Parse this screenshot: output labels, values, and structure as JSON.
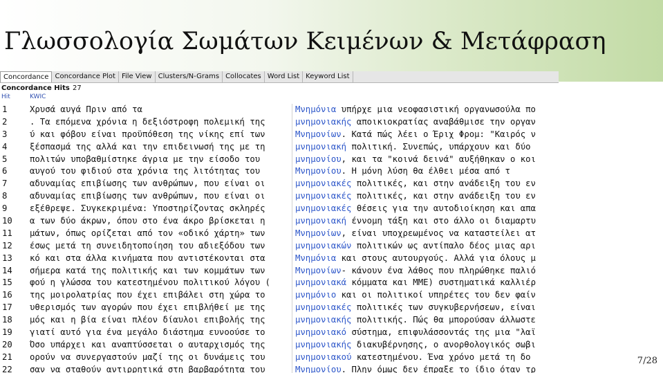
{
  "slide": {
    "title": "Γλωσσολογία Σωμάτων Κειμένων & Μετάφραση",
    "page_number": "7/28"
  },
  "app": {
    "tabs": [
      {
        "label": "Concordance",
        "active": true
      },
      {
        "label": "Concordance Plot",
        "active": false
      },
      {
        "label": "File View",
        "active": false
      },
      {
        "label": "Clusters/N-Grams",
        "active": false
      },
      {
        "label": "Collocates",
        "active": false
      },
      {
        "label": "Word List",
        "active": false
      },
      {
        "label": "Keyword List",
        "active": false
      }
    ],
    "hits_label": "Concordance Hits",
    "hits_count": "27",
    "columns": {
      "hit": "Hit",
      "kwic": "KWIC"
    },
    "keyword_color": "#2b55c9",
    "rows": [
      {
        "num": "1",
        "left": "Χρυσά αυγά  Πριν από τα ",
        "kw": "Μνημόνια",
        "right": " υπήρχε μια νεοφασιστική οργανωσούλα πο"
      },
      {
        "num": "2",
        "left": ". Τα επόμενα χρόνια η δεξιόστροφη πολεμική της ",
        "kw": "μνημονιακής",
        "right": " αποικιοκρατίας αναβάθμισε την οργαν"
      },
      {
        "num": "3",
        "left": "ύ και φόβου είναι προϋπόθεση της νίκης επί των ",
        "kw": "Μνημονίων",
        "right": ". Κατά πώς λέει ο Έριχ Φρομ: \"Καιρός ν"
      },
      {
        "num": "4",
        "left": "ξέσπασμά της αλλά και την επιδεινωσή της με τη ",
        "kw": "μνημονιακή",
        "right": " πολιτική.  Συνεπώς, υπάρχουν και δύο"
      },
      {
        "num": "5",
        "left": " πολιτών υποβαθμίστηκε άγρια με την είσοδο του ",
        "kw": "μνημονίου",
        "right": ", και τα \"κοινά δεινά\" αυξήθηκαν ο κοι"
      },
      {
        "num": "6",
        "left": " αυγού του φιδιού στα χρόνια της λιτότητας του ",
        "kw": "Μνημονίου",
        "right": ".    Η μόνη λύση θα έλθει μέσα από τ"
      },
      {
        "num": "7",
        "left": "αδυναμίας επιβίωσης των ανθρώπων, που είναι οι ",
        "kw": "μνημονιακές",
        "right": " πολιτικές, και στην ανάδειξη του εν"
      },
      {
        "num": "8",
        "left": "αδυναμίας επιβίωσης των ανθρώπων, που είναι οι ",
        "kw": "μνημονιακές",
        "right": " πολιτικές, και στην ανάδειξη του εν"
      },
      {
        "num": "9",
        "left": "εξέθρεψε. Συγκεκριμένα: Υποστηρίζοντας σκληρές ",
        "kw": "μνημονιακές",
        "right": " θέσεις για την αυτοδιοίκηση και απα"
      },
      {
        "num": "10",
        "left": "α των δύο άκρων, όπου στο ένα άκρο βρίσκεται η ",
        "kw": "μνημονιακή",
        "right": " έννομη τάξη και στο άλλο οι διαμαρτυ"
      },
      {
        "num": "11",
        "left": "μάτων, όπως ορίζεται από τον «οδικό χάρτη» των ",
        "kw": "Μνημονίων",
        "right": ", είναι υποχρεωμένος να καταστείλει ατ"
      },
      {
        "num": "12",
        "left": "έσως μετά τη συνειδητοποίηση του αδιεξόδου των ",
        "kw": "μνημονιακών",
        "right": " πολιτικών ως αντίπαλο δέος μιας αρι"
      },
      {
        "num": "13",
        "left": "κό και στα άλλα κινήματα που αντιστέκονται στα ",
        "kw": "Μνημόνια",
        "right": " και στους αυτουργούς. Αλλά για όλους μ"
      },
      {
        "num": "14",
        "left": "σήμερα κατά της πολιτικής και των κομμάτων των ",
        "kw": "Μνημονίων",
        "right": "- κάνουν ένα λάθος που πληρώθηκε παλιό"
      },
      {
        "num": "15",
        "left": "φού η γλώσσα του κατεστημένου πολιτικού λόγου ( ",
        "kw": "μνημονιακά",
        "right": " κόμματα και ΜΜΕ) συστηματικά καλλιέρ"
      },
      {
        "num": "16",
        "left": "της μοιρολατρίας που έχει επιβάλει στη χώρα το ",
        "kw": "μνημόνιο",
        "right": " και οι πολιτικοί υπηρέτες του δεν φαίν"
      },
      {
        "num": "17",
        "left": "υθερισμός των αγορών που έχει επιβλήθεί με της ",
        "kw": "μνημονιακές",
        "right": " πολιτικές των συγκυβερνήσεων, είναι"
      },
      {
        "num": "18",
        "left": "μός και η βία είναι πλέον δίαυλοι επιβολής της ",
        "kw": "μνημονιακής",
        "right": " πολιτικής. Πώς θα μπορούσαν άλλωστε"
      },
      {
        "num": "19",
        "left": "γιατί αυτό για ένα μεγάλο διάστημα ευνοούσε το ",
        "kw": "μνημονιακό",
        "right": " σύστημα, επιφυλάσσοντάς της μια \"λαϊ"
      },
      {
        "num": "20",
        "left": "Όσο υπάρχει και αναπτύσσεται ο αυταρχισμός της ",
        "kw": "μνημονιακής",
        "right": " διακυβέρνησης, ο ανορθολογικός σωβι"
      },
      {
        "num": "21",
        "left": "ορούν να συνεργαστούν μαζί της οι δυνάμεις του ",
        "kw": "μνημονιακού",
        "right": " κατεστημένου. Ένα χρόνο μετά τη δο"
      },
      {
        "num": "22",
        "left": "σαν να σταθούν αντιρρητικά στη βαρβαρότητα του ",
        "kw": "Μνημονίου",
        "right": ". Πλην όμως δεν έπραξε το ίδιο όταν τρ"
      }
    ]
  }
}
